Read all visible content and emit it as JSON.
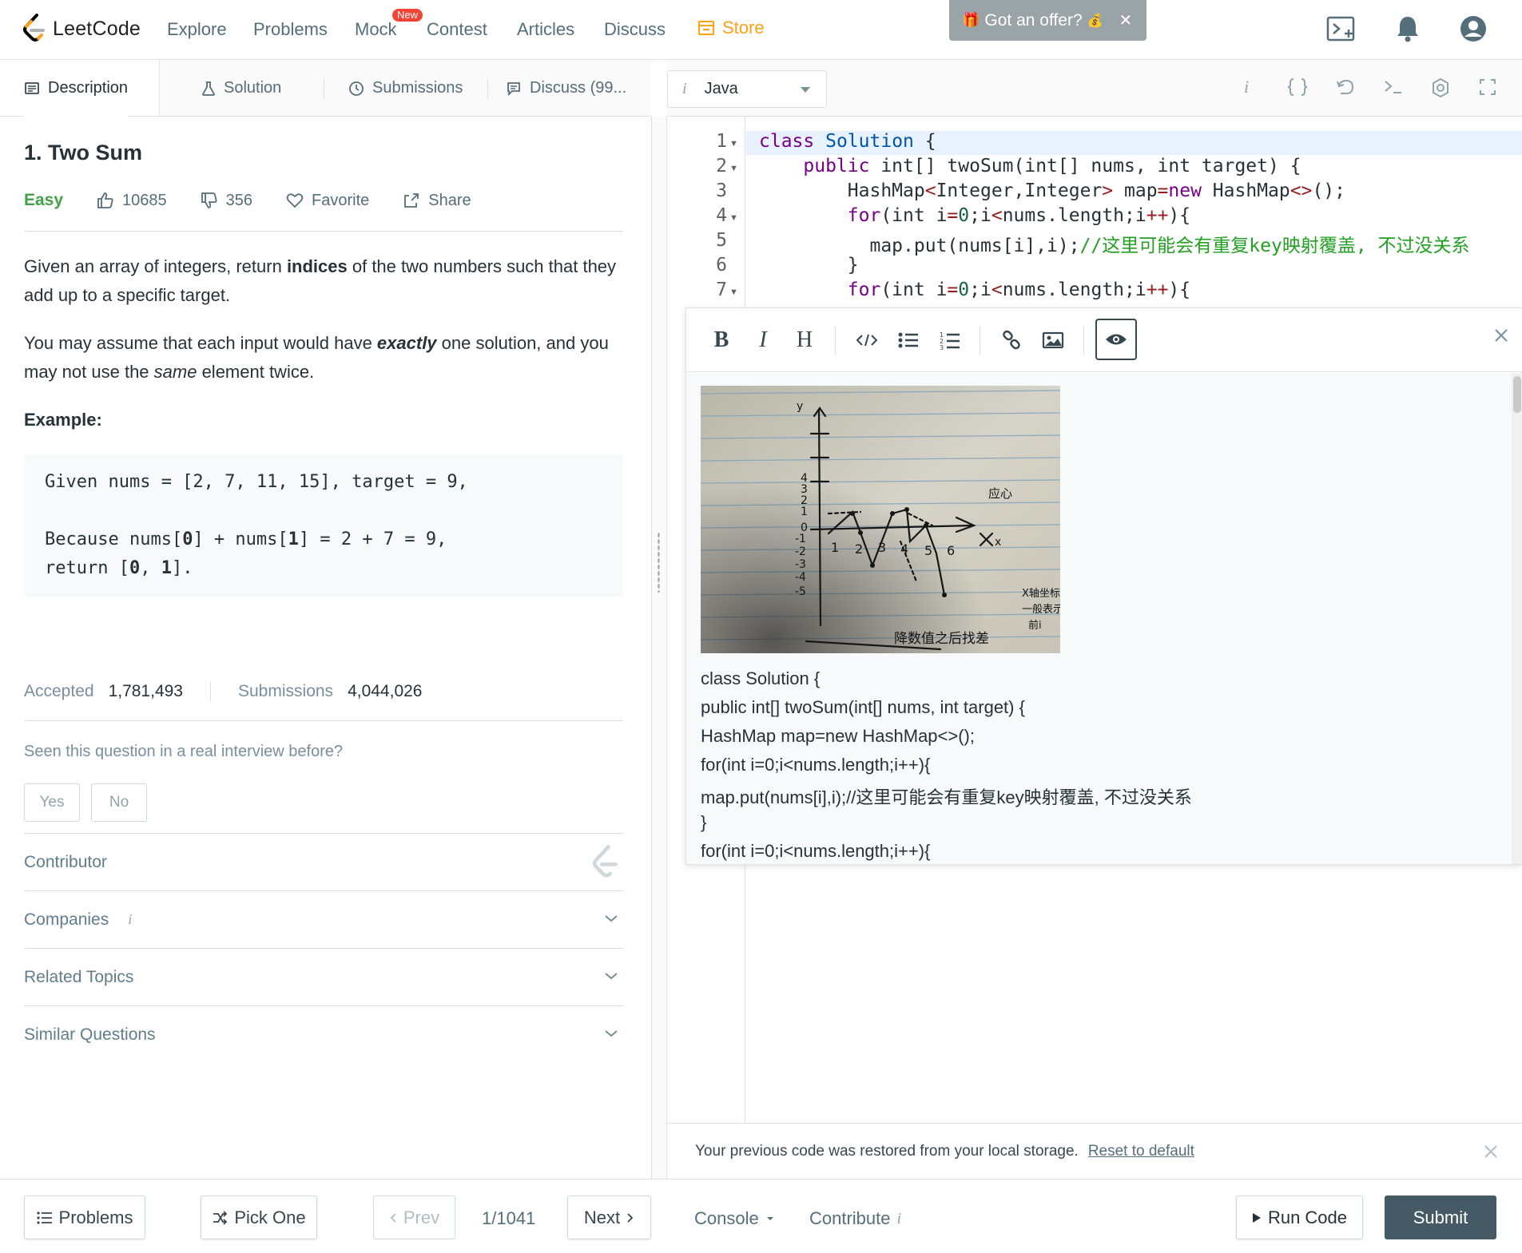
{
  "nav": {
    "logo_text": "LeetCode",
    "links": [
      "Explore",
      "Problems",
      "Mock",
      "Contest",
      "Articles",
      "Discuss"
    ],
    "store_label": "Store",
    "new_badge": "New",
    "offer_text": "Got an offer?",
    "offer_close": "✕",
    "icons": [
      "playground-icon",
      "bell-icon",
      "user-avatar-icon"
    ],
    "accent_color": "#ffa116"
  },
  "left_tabs": [
    "Description",
    "Solution",
    "Submissions",
    "Discuss (99..."
  ],
  "problem": {
    "title": "1. Two Sum",
    "difficulty": "Easy",
    "likes": "10685",
    "dislikes": "356",
    "favorite_label": "Favorite",
    "share_label": "Share",
    "para1": {
      "a": "Given an array of integers, return ",
      "b": "indices",
      "c": " of the two numbers such that they add up to a specific target."
    },
    "para2": {
      "a": "You may assume that each input would have ",
      "b": "exactly",
      "c": " one solution, and you may not use the ",
      "d": "same",
      "e": " element twice."
    },
    "example_label": "Example:",
    "example_lines": [
      "Given nums = [2, 7, 11, 15], target = 9,",
      "Because nums[",
      "0",
      "] + nums[",
      "1",
      "] = 2 + 7 = 9,",
      "return [",
      "0",
      ", ",
      "1",
      "]."
    ],
    "accepted_label": "Accepted",
    "accepted_value": "1,781,493",
    "submissions_label": "Submissions",
    "submissions_value": "4,044,026",
    "seen_question": "Seen this question in a real interview before?",
    "yes": "Yes",
    "no": "No",
    "sections": [
      "Contributor",
      "Companies",
      "Related Topics",
      "Similar Questions"
    ],
    "companies_info": "i",
    "difficulty_color": "#43a047"
  },
  "editor": {
    "language": "Java",
    "lang_info": "i",
    "toolbar_icons": [
      "info-icon",
      "braces-icon",
      "reset-icon",
      "console-icon",
      "settings-icon",
      "fullscreen-icon"
    ],
    "line_numbers": [
      "1",
      "2",
      "3",
      "4",
      "5",
      "6",
      "7"
    ],
    "code": {
      "l1": [
        "class",
        " ",
        "Solution",
        " {"
      ],
      "l2": [
        "    ",
        "public",
        " int[] twoSum(int[] nums, int target) {"
      ],
      "l3": [
        "        HashMap",
        "<",
        "Integer,Integer",
        ">",
        " map",
        "=",
        "new",
        " HashMap",
        "<>",
        "();"
      ],
      "l4": [
        "        ",
        "for",
        "(int i",
        "=",
        "0",
        ";i",
        "<",
        "nums.length;i",
        "++",
        "){"
      ],
      "l5": [
        "          map.put(nums[i],i);",
        "//这里可能会有重复key映射覆盖, 不过没关系"
      ],
      "l6": [
        "        }"
      ],
      "l7": [
        "        ",
        "for",
        "(int i",
        "=",
        "0",
        ";i",
        "<",
        "nums.length;i",
        "++",
        "){"
      ]
    }
  },
  "notes": {
    "toolbar": [
      "bold-icon",
      "italic-icon",
      "heading-icon",
      "code-icon",
      "bulleted-list-icon",
      "numbered-list-icon",
      "link-icon",
      "image-icon",
      "preview-eye-icon"
    ],
    "bold": "B",
    "italic": "I",
    "heading": "H",
    "close": "✕",
    "lines": [
      "class Solution {",
      "public int[] twoSum(int[] nums, int target) {",
      "HashMap map=new HashMap<>();",
      "for(int i=0;i<nums.length;i++){",
      "map.put(nums[i],i);//这里可能会有重复key映射覆盖, 不过没关系",
      "}",
      "for(int i=0;i<nums.length;i++){"
    ],
    "photo": {
      "y_ticks": [
        "4",
        "3",
        "2",
        "1",
        "0",
        "-1",
        "-2",
        "-3",
        "-4",
        "-5"
      ],
      "x_ticks": [
        "1",
        "2",
        "3",
        "4",
        "5",
        "6"
      ],
      "axis_y": "y",
      "axis_x": "x",
      "note_top": "应心",
      "note_right1": "X轴坐标",
      "note_right2": "一般表示",
      "note_right3": "前i",
      "note_bottom": "降数值之后找差"
    }
  },
  "restored": {
    "message": "Your previous code was restored from your local storage.",
    "reset_link": "Reset to default"
  },
  "bottom": {
    "problems": "Problems",
    "pick_one": "Pick One",
    "prev": "Prev",
    "page": "1/1041",
    "next": "Next",
    "console": "Console",
    "contribute": "Contribute",
    "contribute_info": "i",
    "run_code": "Run Code",
    "submit": "Submit"
  }
}
